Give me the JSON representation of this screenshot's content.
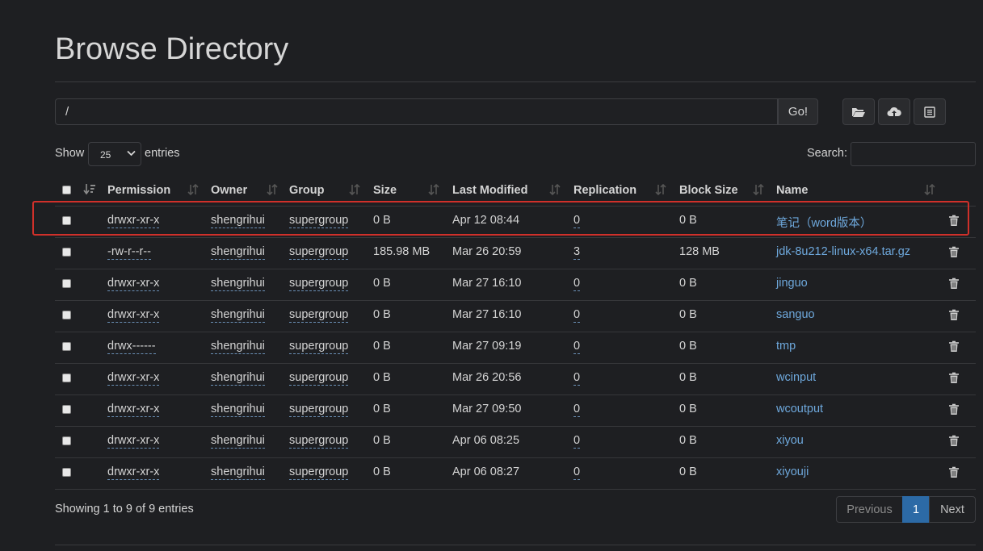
{
  "page": {
    "title": "Browse Directory"
  },
  "toolbar": {
    "path_value": "/",
    "go_label": "Go!"
  },
  "length_menu": {
    "show_label": "Show",
    "selected": "25",
    "entries_label": "entries"
  },
  "search": {
    "label": "Search:",
    "value": ""
  },
  "table": {
    "columns": [
      "Permission",
      "Owner",
      "Group",
      "Size",
      "Last Modified",
      "Replication",
      "Block Size",
      "Name"
    ],
    "rows": [
      {
        "permission": "drwxr-xr-x",
        "owner": "shengrihui",
        "group": "supergroup",
        "size": "0 B",
        "modified": "Apr 12 08:44",
        "replication": "0",
        "block_size": "0 B",
        "name": "笔记（word版本）"
      },
      {
        "permission": "-rw-r--r--",
        "owner": "shengrihui",
        "group": "supergroup",
        "size": "185.98 MB",
        "modified": "Mar 26 20:59",
        "replication": "3",
        "block_size": "128 MB",
        "name": "jdk-8u212-linux-x64.tar.gz"
      },
      {
        "permission": "drwxr-xr-x",
        "owner": "shengrihui",
        "group": "supergroup",
        "size": "0 B",
        "modified": "Mar 27 16:10",
        "replication": "0",
        "block_size": "0 B",
        "name": "jinguo"
      },
      {
        "permission": "drwxr-xr-x",
        "owner": "shengrihui",
        "group": "supergroup",
        "size": "0 B",
        "modified": "Mar 27 16:10",
        "replication": "0",
        "block_size": "0 B",
        "name": "sanguo"
      },
      {
        "permission": "drwx------",
        "owner": "shengrihui",
        "group": "supergroup",
        "size": "0 B",
        "modified": "Mar 27 09:19",
        "replication": "0",
        "block_size": "0 B",
        "name": "tmp"
      },
      {
        "permission": "drwxr-xr-x",
        "owner": "shengrihui",
        "group": "supergroup",
        "size": "0 B",
        "modified": "Mar 26 20:56",
        "replication": "0",
        "block_size": "0 B",
        "name": "wcinput"
      },
      {
        "permission": "drwxr-xr-x",
        "owner": "shengrihui",
        "group": "supergroup",
        "size": "0 B",
        "modified": "Mar 27 09:50",
        "replication": "0",
        "block_size": "0 B",
        "name": "wcoutput"
      },
      {
        "permission": "drwxr-xr-x",
        "owner": "shengrihui",
        "group": "supergroup",
        "size": "0 B",
        "modified": "Apr 06 08:25",
        "replication": "0",
        "block_size": "0 B",
        "name": "xiyou"
      },
      {
        "permission": "drwxr-xr-x",
        "owner": "shengrihui",
        "group": "supergroup",
        "size": "0 B",
        "modified": "Apr 06 08:27",
        "replication": "0",
        "block_size": "0 B",
        "name": "xiyouji"
      }
    ]
  },
  "footer": {
    "info": "Showing 1 to 9 of 9 entries"
  },
  "pagination": {
    "previous": "Previous",
    "current": "1",
    "next": "Next"
  },
  "colors": {
    "background": "#1e1f22",
    "link": "#6ea8dc",
    "active_page": "#2c6aa6",
    "highlight": "#d0302a"
  }
}
